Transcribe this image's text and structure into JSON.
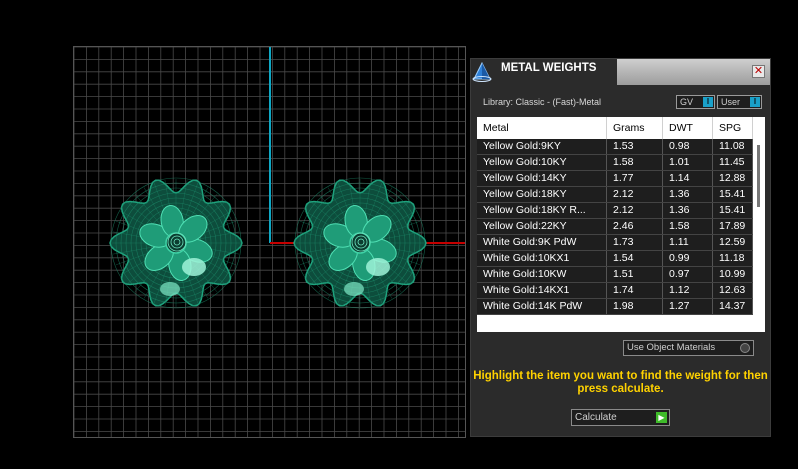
{
  "panel": {
    "title": "METAL WEIGHTS",
    "close_glyph": "✕",
    "library": "Library: Classic - (Fast)-Metal",
    "toggle_gv": "GV",
    "toggle_user": "User",
    "toggle_chip": "I",
    "use_object_materials": "Use Object Materials",
    "hint": "Highlight the item you want to find the weight for then press calculate.",
    "calculate_label": "Calculate",
    "calculate_arrow": "▶"
  },
  "table": {
    "columns": [
      "Metal",
      "Grams",
      "DWT",
      "SPG"
    ],
    "rows": [
      [
        "Yellow Gold:9KY",
        "1.53",
        "0.98",
        "11.08"
      ],
      [
        "Yellow Gold:10KY",
        "1.58",
        "1.01",
        "11.45"
      ],
      [
        "Yellow Gold:14KY",
        "1.77",
        "1.14",
        "12.88"
      ],
      [
        "Yellow Gold:18KY",
        "2.12",
        "1.36",
        "15.41"
      ],
      [
        "Yellow Gold:18KY R...",
        "2.12",
        "1.36",
        "15.41"
      ],
      [
        "Yellow Gold:22KY",
        "2.46",
        "1.58",
        "17.89"
      ],
      [
        "White Gold:9K PdW",
        "1.73",
        "1.11",
        "12.59"
      ],
      [
        "White Gold:10KX1",
        "1.54",
        "0.99",
        "11.18"
      ],
      [
        "White Gold:10KW",
        "1.51",
        "0.97",
        "10.99"
      ],
      [
        "White Gold:14KX1",
        "1.74",
        "1.12",
        "12.63"
      ],
      [
        "White Gold:14K PdW",
        "1.98",
        "1.27",
        "14.37"
      ]
    ]
  },
  "icons": {
    "app": "pyramid-icon",
    "close": "close-icon",
    "model": "flower-earring-model"
  },
  "colors": {
    "accent_yellow": "#ffd200",
    "model_green": "#1fa37e",
    "axis_cyan": "#0fa8c4",
    "axis_red": "#c40000"
  }
}
